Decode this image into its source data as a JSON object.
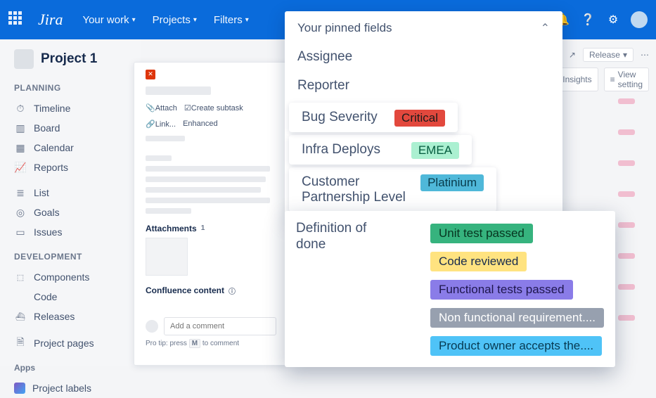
{
  "topnav": {
    "logo": "Jira",
    "items": [
      "Your work",
      "Projects",
      "Filters"
    ]
  },
  "toolbar_right": {
    "release": "Release",
    "insights": "Insights",
    "view_settings": "View setting"
  },
  "sidebar": {
    "project_title": "Project 1",
    "planning_label": "PLANNING",
    "planning_items": [
      {
        "icon": "⏱",
        "label": "Timeline"
      },
      {
        "icon": "▥",
        "label": "Board"
      },
      {
        "icon": "▦",
        "label": "Calendar"
      },
      {
        "icon": "📈",
        "label": "Reports"
      },
      {
        "icon": "≣",
        "label": "List"
      },
      {
        "icon": "◎",
        "label": "Goals"
      },
      {
        "icon": "▭",
        "label": "Issues"
      }
    ],
    "development_label": "DEVELOPMENT",
    "dev_items": [
      {
        "icon": "⬚",
        "label": "Components"
      },
      {
        "icon": "</>",
        "label": "Code"
      },
      {
        "icon": "⛴",
        "label": "Releases"
      }
    ],
    "project_pages": {
      "icon": "🗎",
      "label": "Project pages"
    },
    "apps_label": "Apps",
    "apps_item": "Project labels"
  },
  "modal": {
    "actions": {
      "attach": "Attach",
      "subtask": "Create subtask",
      "link": "Link...",
      "enhanced": "Enhanced"
    },
    "attachments_label": "Attachments",
    "attachments_count": "1",
    "confluence_label": "Confluence content",
    "comment_placeholder": "Add a comment",
    "protip_pre": "Pro tip: press ",
    "protip_key": "M",
    "protip_post": " to comment"
  },
  "panel": {
    "title": "Your pinned fields",
    "assignee": "Assignee",
    "reporter": "Reporter",
    "bug_severity": {
      "label": "Bug Severity",
      "value": "Critical"
    },
    "infra": {
      "label": "Infra Deploys",
      "value": "EMEA"
    },
    "cpl": {
      "label": "Customer Partnership Level",
      "value": "Platinium"
    },
    "dod": {
      "label": "Definition of done",
      "tags": [
        "Unit test passed",
        "Code reviewed",
        "Functional tests passed",
        "Non functional requirement....",
        "Product owner accepts the...."
      ]
    }
  }
}
